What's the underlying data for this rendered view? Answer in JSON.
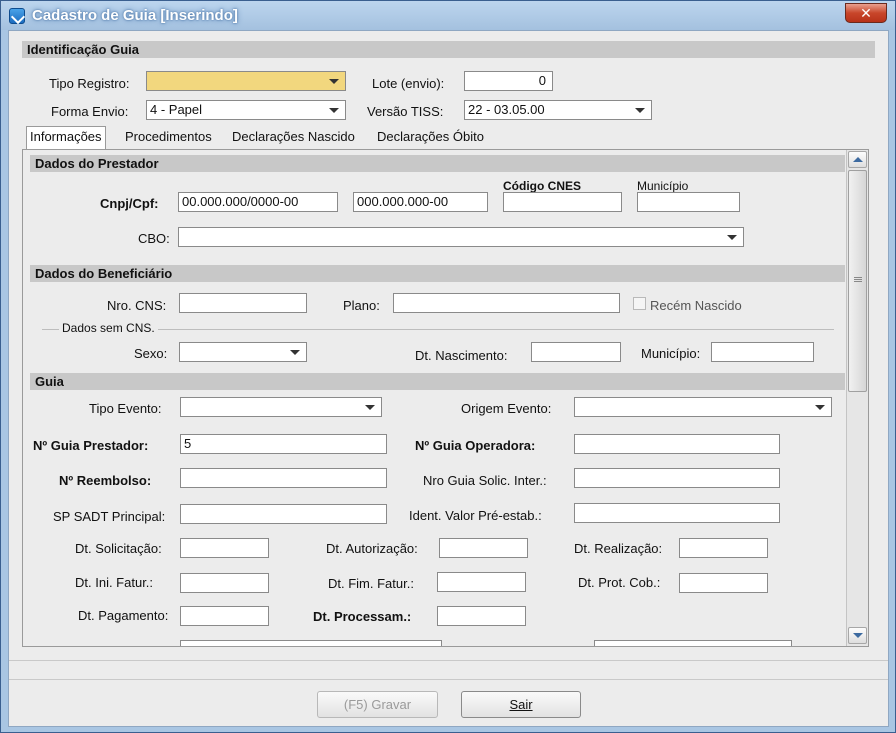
{
  "window": {
    "title": "Cadastro de Guia [Inserindo]",
    "close_glyph": "✕"
  },
  "identificacao": {
    "header": "Identificação Guia",
    "tipo_registro_label": "Tipo Registro:",
    "tipo_registro_value": "",
    "lote_label": "Lote (envio):",
    "lote_value": "0",
    "forma_envio_label": "Forma Envio:",
    "forma_envio_value": "4 - Papel",
    "versao_tiss_label": "Versão TISS:",
    "versao_tiss_value": "22 - 03.05.00"
  },
  "tabs": [
    {
      "label": "Informações"
    },
    {
      "label": "Procedimentos"
    },
    {
      "label": "Declarações Nascido"
    },
    {
      "label": "Declarações Óbito"
    }
  ],
  "prestador": {
    "header": "Dados do Prestador",
    "cnpj_label": "Cnpj/Cpf:",
    "cnpj_value": "00.000.000/0000-00",
    "cpf_value": "000.000.000-00",
    "cnes_label": "Código CNES",
    "municipio_label": "Município",
    "cbo_label": "CBO:"
  },
  "beneficiario": {
    "header": "Dados do Beneficiário",
    "cns_label": "Nro. CNS:",
    "plano_label": "Plano:",
    "recem_nascido_label": "Recém Nascido",
    "sem_cns_label": "Dados sem CNS.",
    "sexo_label": "Sexo:",
    "dt_nascimento_label": "Dt. Nascimento:",
    "municipio_label": "Município:"
  },
  "guia": {
    "header": "Guia",
    "tipo_evento_label": "Tipo Evento:",
    "origem_evento_label": "Origem Evento:",
    "n_guia_prestador_label": "Nº Guia Prestador:",
    "n_guia_prestador_value": "5",
    "n_guia_operadora_label": "Nº Guia Operadora:",
    "n_reembolso_label": "Nº Reembolso:",
    "nro_guia_solic_label": "Nro Guia Solic. Inter.:",
    "sp_sadt_label": "SP SADT Principal:",
    "ident_valor_label": "Ident. Valor Pré-estab.:",
    "dt_solicitacao_label": "Dt. Solicitação:",
    "dt_autorizacao_label": "Dt. Autorização:",
    "dt_realizacao_label": "Dt. Realização:",
    "dt_ini_fatur_label": "Dt. Ini. Fatur.:",
    "dt_fim_fatur_label": "Dt. Fim. Fatur.:",
    "dt_prot_cob_label": "Dt. Prot. Cob.:",
    "dt_pagamento_label": "Dt. Pagamento:",
    "dt_processam_label": "Dt. Processam.:"
  },
  "buttons": {
    "gravar_label": "(F5)  Gravar",
    "sair_label": "Sair"
  },
  "colors": {
    "highlight_field": "#f2d77e",
    "section_header": "#c8c8c8",
    "window_frame": "#a9c6e3"
  }
}
